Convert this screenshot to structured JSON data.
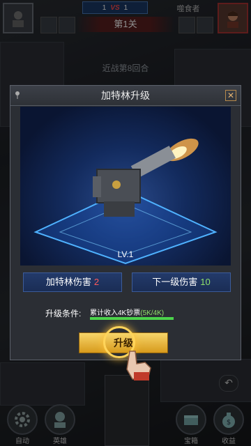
{
  "topbar": {
    "score_left": "1",
    "vs": "VS",
    "score_right": "1",
    "opponent_name": "噬食者",
    "stage_label": "第1关"
  },
  "round_text": "近战第8回合",
  "dialog": {
    "title": "加特林升级",
    "level": "LV.1",
    "damage_label": "加特林伤害",
    "damage_value": "2",
    "next_label": "下一级伤害",
    "next_value": "10",
    "condition_label": "升级条件:",
    "condition_text": "累计收入4K钞票",
    "progress_text": "(5K/4K)",
    "progress_fraction": 1.0,
    "upgrade_button": "升级"
  },
  "bottom_nav": [
    {
      "label": "自动",
      "icon": "gear-icon"
    },
    {
      "label": "英雄",
      "icon": "hero-icon"
    },
    {
      "label": "宝箱",
      "icon": "chest-icon"
    },
    {
      "label": "收益",
      "icon": "money-bag-icon"
    }
  ],
  "colors": {
    "accent_gold": "#e3b23c",
    "damage_red": "#ff5a5a",
    "next_green": "#8fe06a",
    "progress_green": "#4bd34b"
  }
}
